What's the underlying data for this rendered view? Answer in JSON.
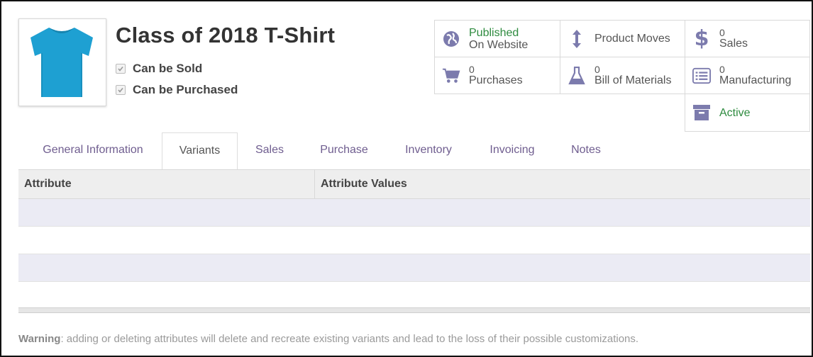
{
  "product": {
    "title": "Class of 2018 T-Shirt",
    "image_icon": "tshirt-image",
    "flags": [
      {
        "label": "Can be Sold",
        "checked": true
      },
      {
        "label": "Can be Purchased",
        "checked": true
      }
    ]
  },
  "smart_buttons": {
    "website": {
      "line1": "Published",
      "line2": "On Website",
      "icon": "globe-icon"
    },
    "product_moves": {
      "label": "Product Moves",
      "icon": "updown-arrow-icon"
    },
    "sales": {
      "count": "0",
      "label": "Sales",
      "icon": "dollar-icon"
    },
    "purchases": {
      "count": "0",
      "label": "Purchases",
      "icon": "cart-icon"
    },
    "bom": {
      "count": "0",
      "label": "Bill of Materials",
      "icon": "flask-icon"
    },
    "manufacturing": {
      "count": "0",
      "label": "Manufacturing",
      "icon": "list-icon"
    },
    "active": {
      "label": "Active",
      "icon": "archive-icon"
    }
  },
  "tabs": [
    {
      "label": "General Information",
      "active": false
    },
    {
      "label": "Variants",
      "active": true
    },
    {
      "label": "Sales",
      "active": false
    },
    {
      "label": "Purchase",
      "active": false
    },
    {
      "label": "Inventory",
      "active": false
    },
    {
      "label": "Invoicing",
      "active": false
    },
    {
      "label": "Notes",
      "active": false
    }
  ],
  "variants_table": {
    "columns": [
      "Attribute",
      "Attribute Values"
    ],
    "rows": []
  },
  "warning": {
    "label": "Warning",
    "text": ": adding or deleting attributes will delete and recreate existing variants and lead to the loss of their possible customizations."
  },
  "colors": {
    "accent": "#7c7bad",
    "published_green": "#2e8b3f",
    "tab_text": "#6f5d8f"
  }
}
